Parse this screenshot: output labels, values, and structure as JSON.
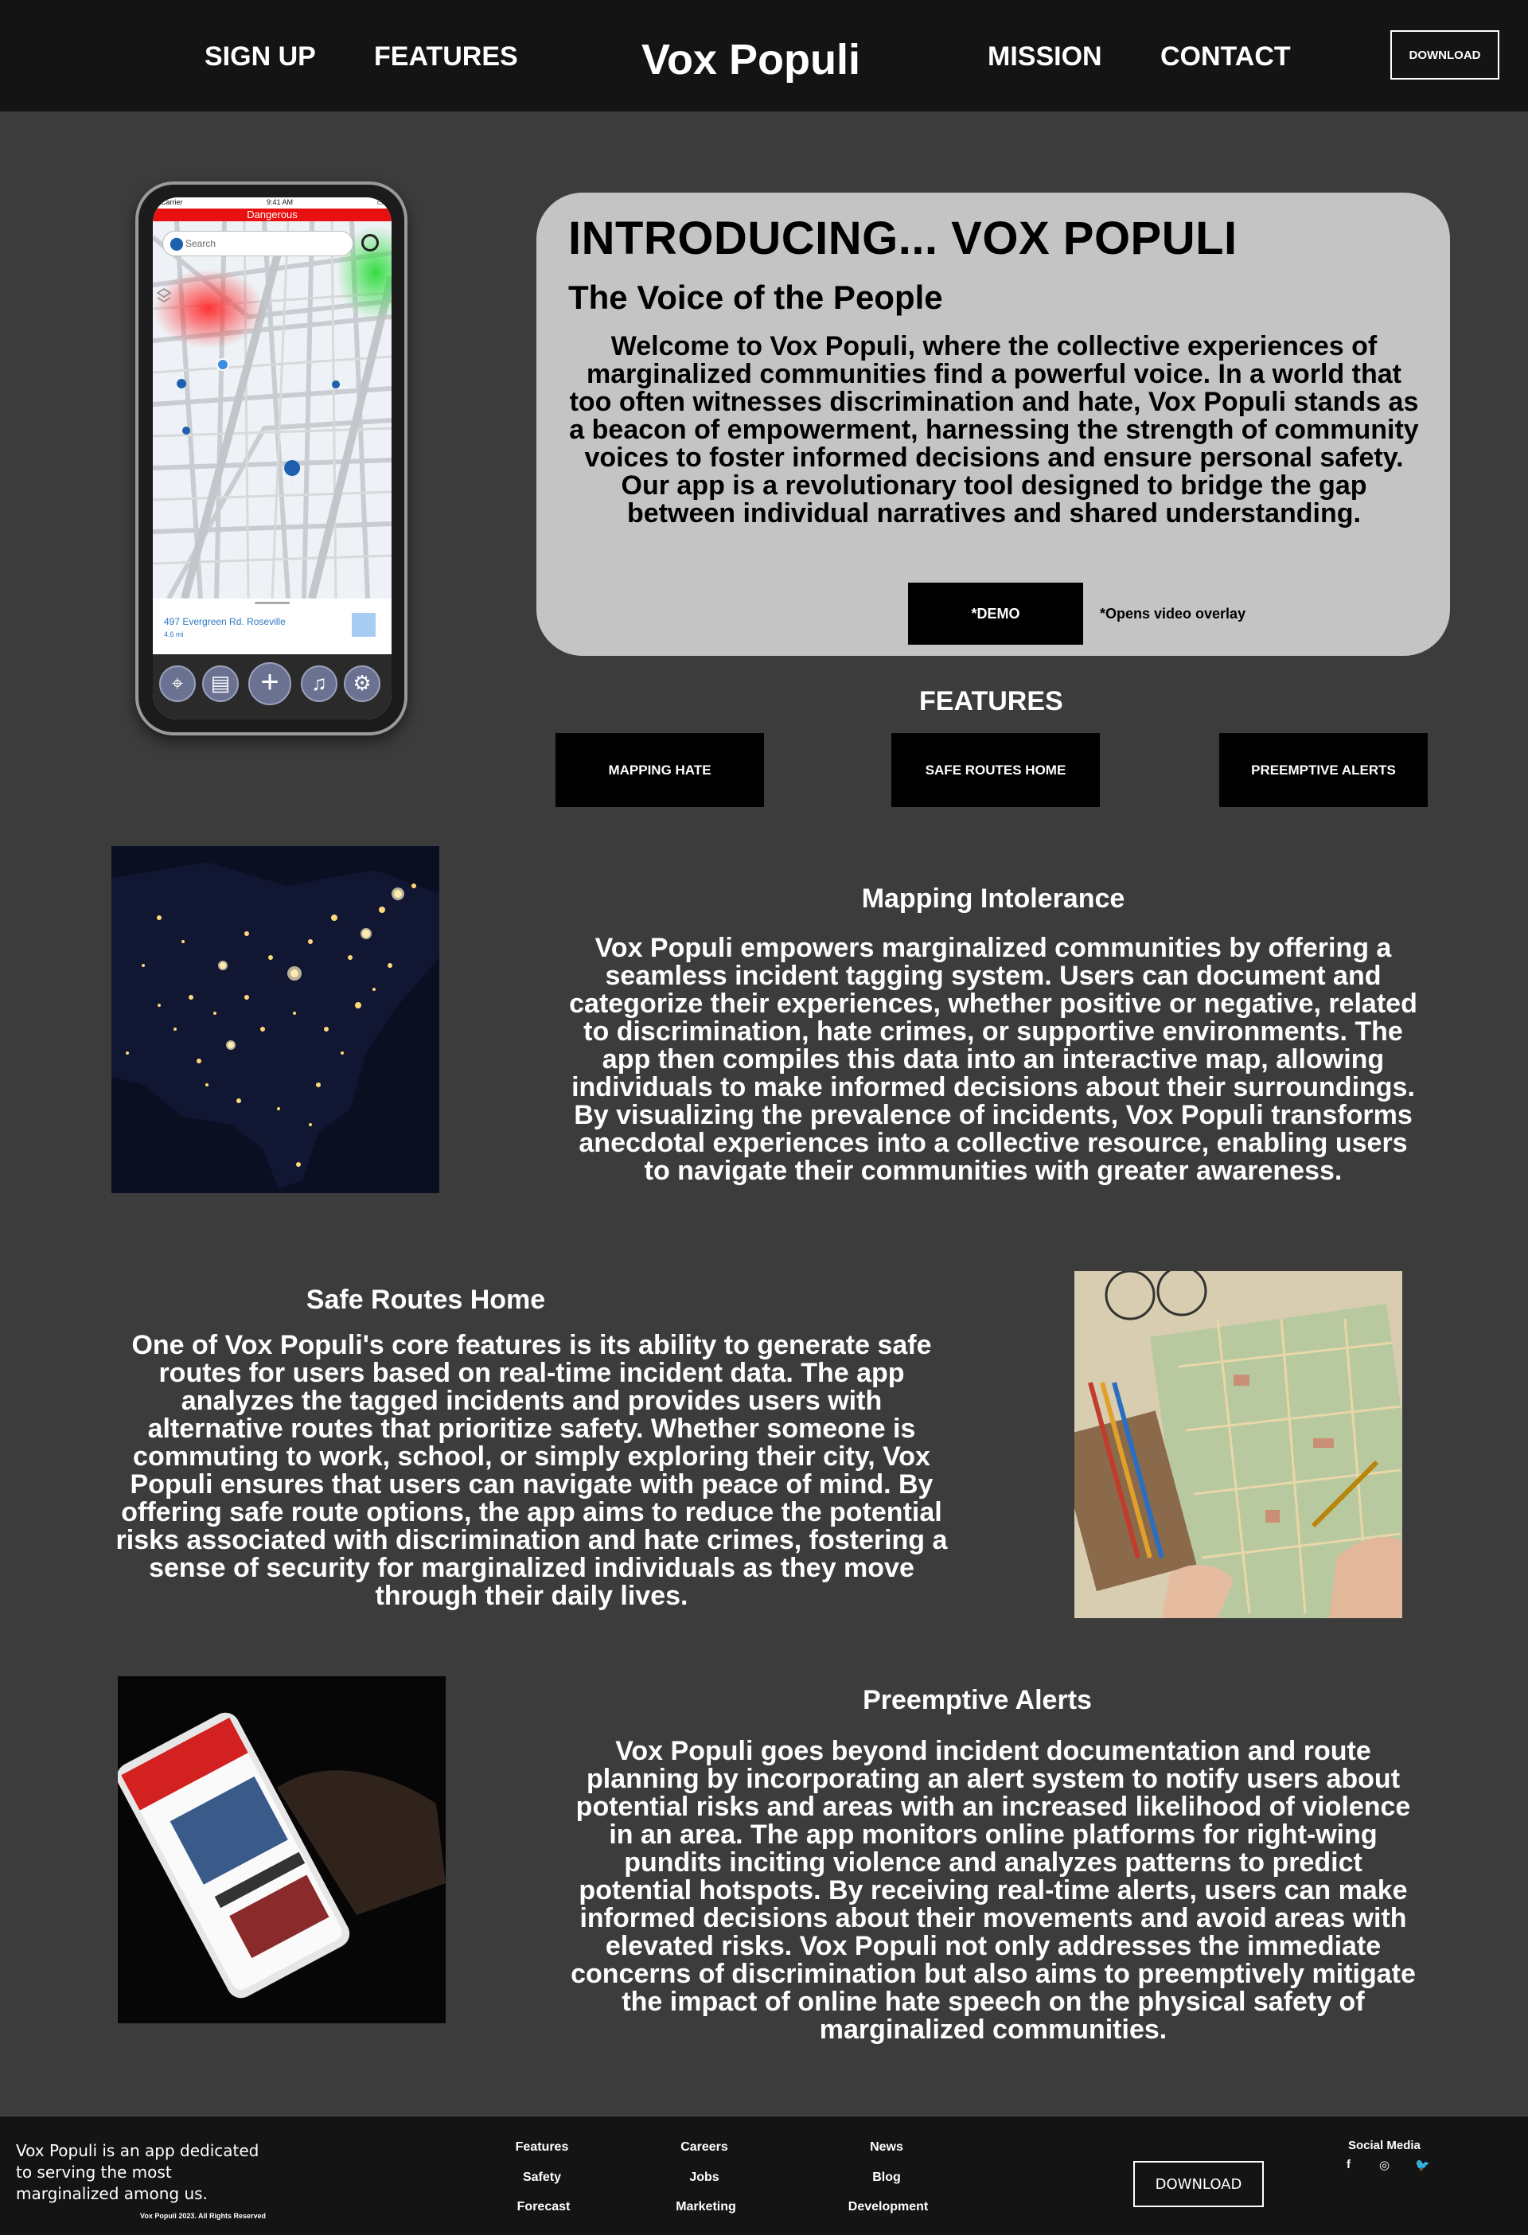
{
  "nav": {
    "sign_up": "SIGN UP",
    "features": "FEATURES",
    "brand": "Vox Populi",
    "mission": "MISSION",
    "contact": "CONTACT",
    "download": "DOWNLOAD"
  },
  "phone": {
    "carrier": "Carrier",
    "time": "9:41 AM",
    "danger_label": "Dangerous",
    "search_placeholder": "Search",
    "address": "497 Evergreen Rd. Roseville",
    "distance": "4.6 mi"
  },
  "intro": {
    "title": "INTRODUCING... VOX POPULI",
    "subtitle": "The Voice of the People",
    "body": "Welcome to Vox Populi, where the collective experiences of marginalized communities find a powerful voice. In a world that too often witnesses discrimination and hate, Vox Populi stands as a beacon of empowerment, harnessing the strength of community voices to foster informed decisions and ensure personal safety. Our app is a revolutionary tool designed to bridge the gap between individual narratives and shared understanding.",
    "demo_label": "*DEMO",
    "demo_note": "*Opens video overlay"
  },
  "features": {
    "title": "FEATURES",
    "buttons": [
      "MAPPING HATE",
      "SAFE ROUTES HOME",
      "PREEMPTIVE ALERTS"
    ]
  },
  "sections": [
    {
      "title": "Mapping Intolerance",
      "body": "Vox Populi empowers marginalized communities by offering a seamless incident tagging system. Users can document and categorize their experiences, whether positive or negative, related to discrimination, hate crimes, or supportive environments. The app then compiles this data into an interactive map, allowing individuals to make informed decisions about their surroundings. By visualizing the prevalence of incidents, Vox Populi transforms anecdotal experiences into a collective resource, enabling users to navigate their communities with greater awareness."
    },
    {
      "title": "Safe Routes Home",
      "body": "One of Vox Populi's core features is its ability to generate safe routes for users based on real-time incident data. The app analyzes the tagged incidents and provides users with alternative routes that prioritize safety. Whether someone is commuting to work, school, or simply exploring their city, Vox Populi ensures that users can navigate with peace of mind. By offering safe route options, the app aims to reduce the potential risks associated with discrimination and hate crimes, fostering a sense of security for marginalized individuals as they move through their daily lives."
    },
    {
      "title": "Preemptive Alerts",
      "body": "Vox Populi goes beyond incident documentation and route planning by incorporating an alert system to notify users about potential risks and areas with an increased likelihood of violence in an area. The app monitors online platforms for right-wing pundits inciting violence and analyzes patterns to predict potential hotspots. By receiving real-time alerts, users can make informed decisions about their movements and avoid areas with elevated risks. Vox Populi not only addresses the immediate concerns of discrimination but also aims to preemptively mitigate the impact of online hate speech on the physical safety of marginalized communities."
    }
  ],
  "footer": {
    "about": "Vox Populi is an app dedicated to serving the most marginalized among us.",
    "rights": "Vox Populi 2023. All Rights Reserved",
    "col1": [
      "Features",
      "Safety",
      "Forecast"
    ],
    "col2": [
      "Careers",
      "Jobs",
      "Marketing"
    ],
    "col3": [
      "News",
      "Blog",
      "Development"
    ],
    "download": "DOWNLOAD",
    "social_title": "Social Media",
    "social_icons": [
      "facebook-icon",
      "instagram-icon",
      "twitter-icon"
    ]
  }
}
